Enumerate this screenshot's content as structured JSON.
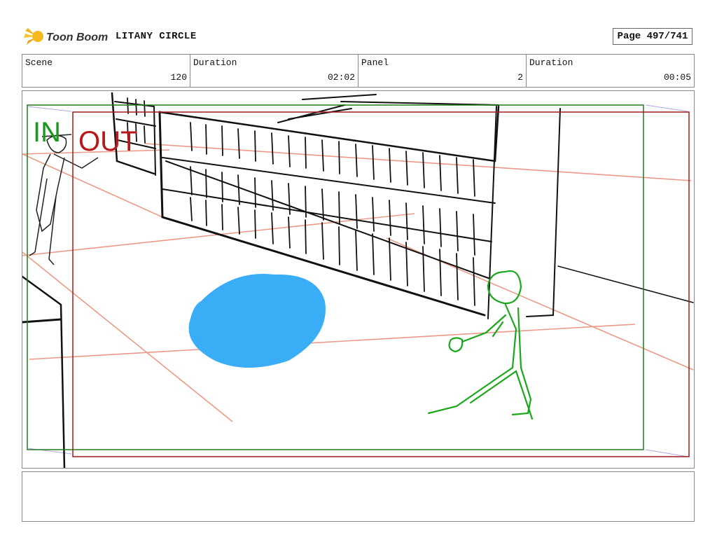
{
  "header": {
    "logo_text": "Toon Boom",
    "project_title": "LITANY CIRCLE",
    "page_indicator": "Page 497/741"
  },
  "info_fields": [
    {
      "label": "Scene",
      "value": "120"
    },
    {
      "label": "Duration",
      "value": "02:02"
    },
    {
      "label": "Panel",
      "value": "2"
    },
    {
      "label": "Duration",
      "value": "00:05"
    }
  ],
  "panel": {
    "in_label": "IN",
    "out_label": "OUT",
    "in_color": "#1a9a1a",
    "out_color": "#b81818"
  },
  "notes": ""
}
